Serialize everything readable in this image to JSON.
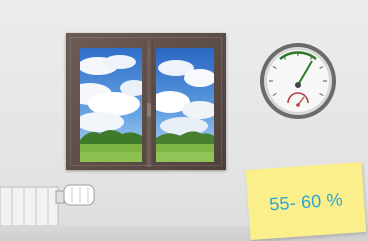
{
  "humidity_note": {
    "text": "55- 60 %",
    "text_color": "#2aa7d6",
    "note_color": "#fbef8c"
  },
  "scene": {
    "wall_color": "#e8e8e8",
    "window_frame_color": "#5c4b45",
    "gauge_needle_color": "#2b7a2b"
  }
}
